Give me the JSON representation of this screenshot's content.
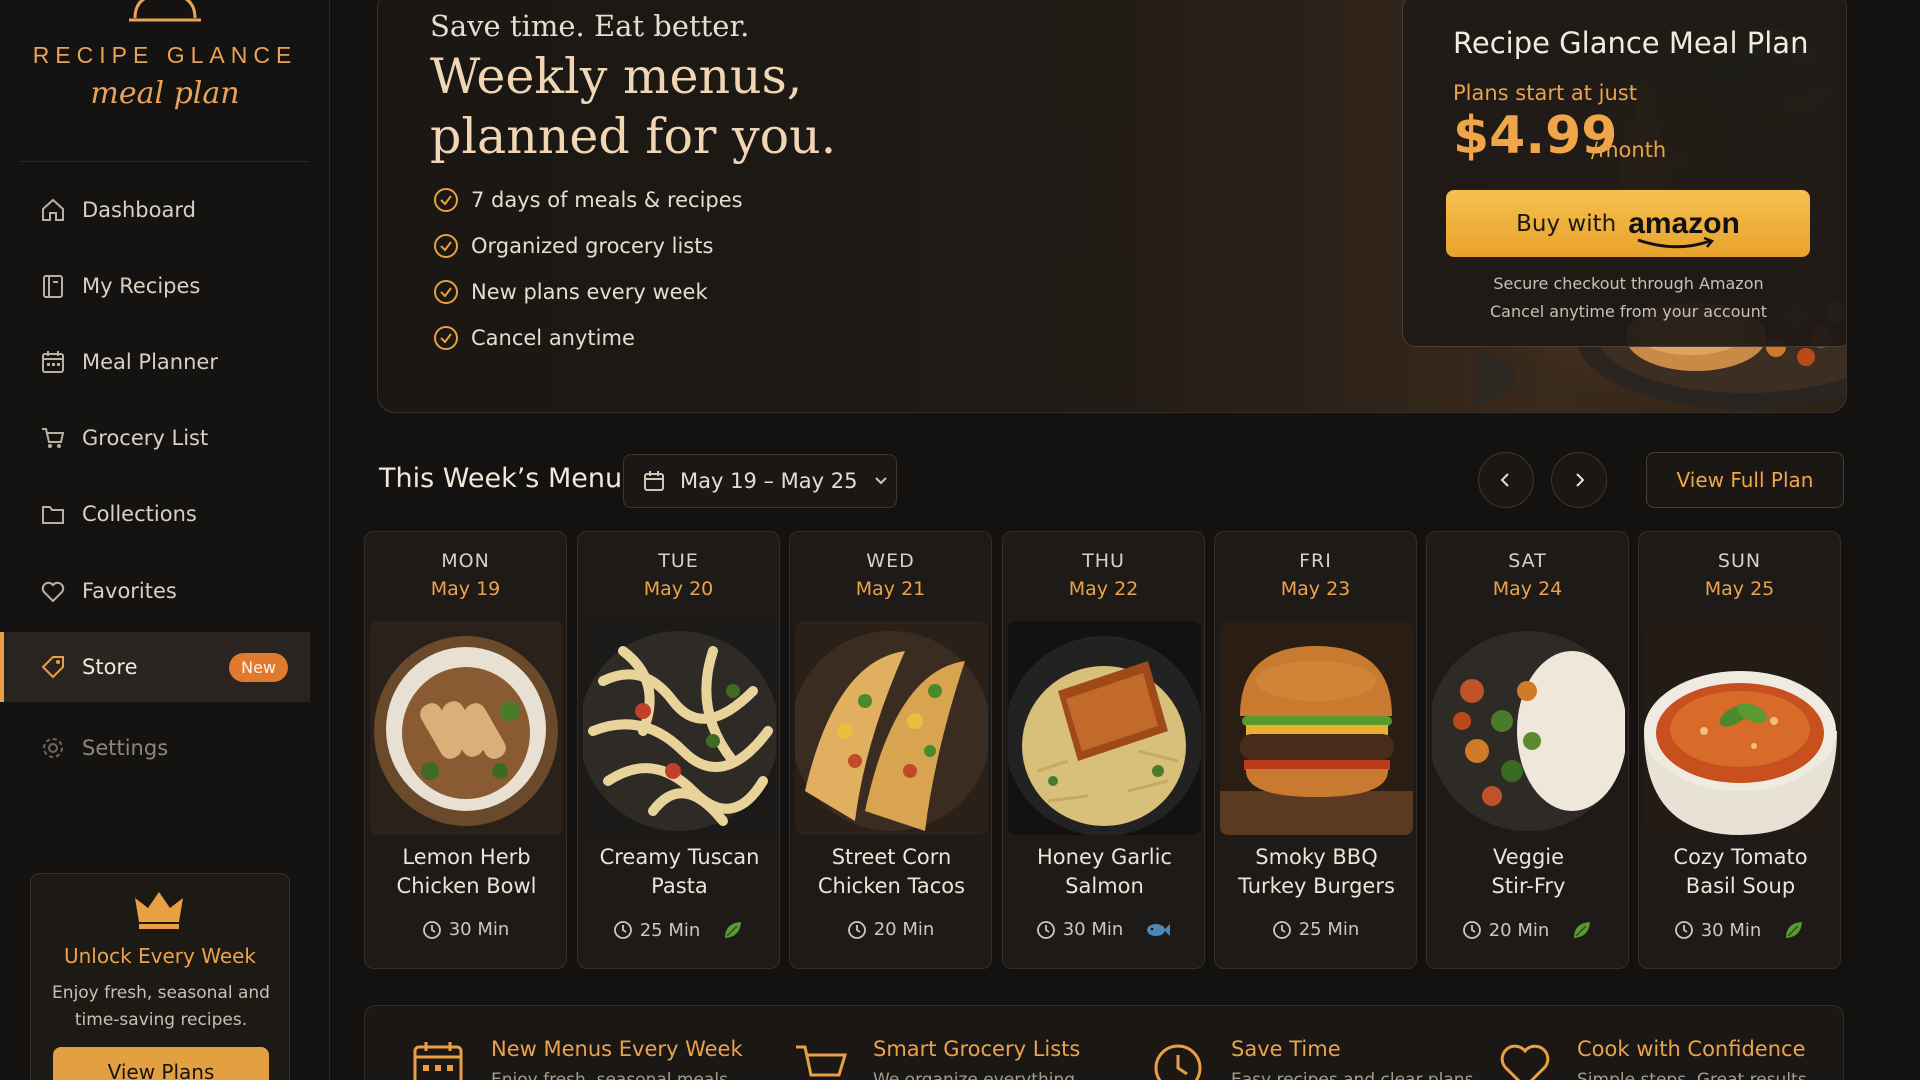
{
  "brand": {
    "title": "RECIPE GLANCE",
    "subtitle": "meal plan"
  },
  "sidebar": {
    "items": [
      {
        "label": "Dashboard",
        "icon": "home-icon"
      },
      {
        "label": "My Recipes",
        "icon": "book-icon"
      },
      {
        "label": "Meal Planner",
        "icon": "calendar-icon"
      },
      {
        "label": "Grocery List",
        "icon": "cart-icon"
      },
      {
        "label": "Collections",
        "icon": "folder-icon"
      },
      {
        "label": "Favorites",
        "icon": "heart-icon"
      },
      {
        "label": "Store",
        "icon": "tag-icon",
        "badge": "New",
        "active": true
      },
      {
        "label": "Settings",
        "icon": "gear-icon"
      }
    ],
    "promo": {
      "title": "Unlock Every Week",
      "text": "Enjoy fresh, seasonal and time-saving recipes.",
      "button": "View Plans"
    }
  },
  "hero": {
    "kicker": "Save time. Eat better.",
    "title": "Weekly menus, planned for you.",
    "features": [
      "7 days of meals & recipes",
      "Organized grocery lists",
      "New plans every week",
      "Cancel anytime"
    ],
    "plan": {
      "title": "Recipe Glance Meal Plan",
      "subtitle": "Plans start at just",
      "price": "$4.99",
      "period": "/month",
      "buy_label": "Buy with",
      "buy_brand": "amazon",
      "note_1": "Secure checkout through Amazon",
      "note_2": "Cancel anytime from your account"
    }
  },
  "menu": {
    "title": "This Week’s Menu",
    "date_range": "May 19 – May 25",
    "view_full": "View Full Plan",
    "days": [
      {
        "day": "MON",
        "date": "May 19",
        "meal_1": "Lemon Herb",
        "meal_2": "Chicken Bowl",
        "time": "30 Min",
        "tag": ""
      },
      {
        "day": "TUE",
        "date": "May 20",
        "meal_1": "Creamy Tuscan",
        "meal_2": "Pasta",
        "time": "25 Min",
        "tag": "leaf-icon"
      },
      {
        "day": "WED",
        "date": "May 21",
        "meal_1": "Street Corn",
        "meal_2": "Chicken Tacos",
        "time": "20 Min",
        "tag": ""
      },
      {
        "day": "THU",
        "date": "May 22",
        "meal_1": "Honey Garlic",
        "meal_2": "Salmon",
        "time": "30 Min",
        "tag": "fish-icon"
      },
      {
        "day": "FRI",
        "date": "May 23",
        "meal_1": "Smoky BBQ",
        "meal_2": "Turkey Burgers",
        "time": "25 Min",
        "tag": ""
      },
      {
        "day": "SAT",
        "date": "May 24",
        "meal_1": "Veggie",
        "meal_2": "Stir-Fry",
        "time": "20 Min",
        "tag": "leaf-icon"
      },
      {
        "day": "SUN",
        "date": "May 25",
        "meal_1": "Cozy Tomato",
        "meal_2": "Basil Soup",
        "time": "30 Min",
        "tag": "leaf-icon"
      }
    ]
  },
  "features": [
    {
      "title": "New Menus Every Week",
      "text": "Enjoy fresh, seasonal meals",
      "icon": "calendar-icon"
    },
    {
      "title": "Smart Grocery Lists",
      "text": "We organize everything",
      "icon": "cart-icon"
    },
    {
      "title": "Save Time",
      "text": "Easy recipes and clear plans",
      "icon": "clock-icon"
    },
    {
      "title": "Cook with Confidence",
      "text": "Simple steps. Great results",
      "icon": "heart-icon"
    }
  ],
  "colors": {
    "accent": "#e8a043",
    "background": "#141210",
    "badge": "#e07a2e"
  }
}
